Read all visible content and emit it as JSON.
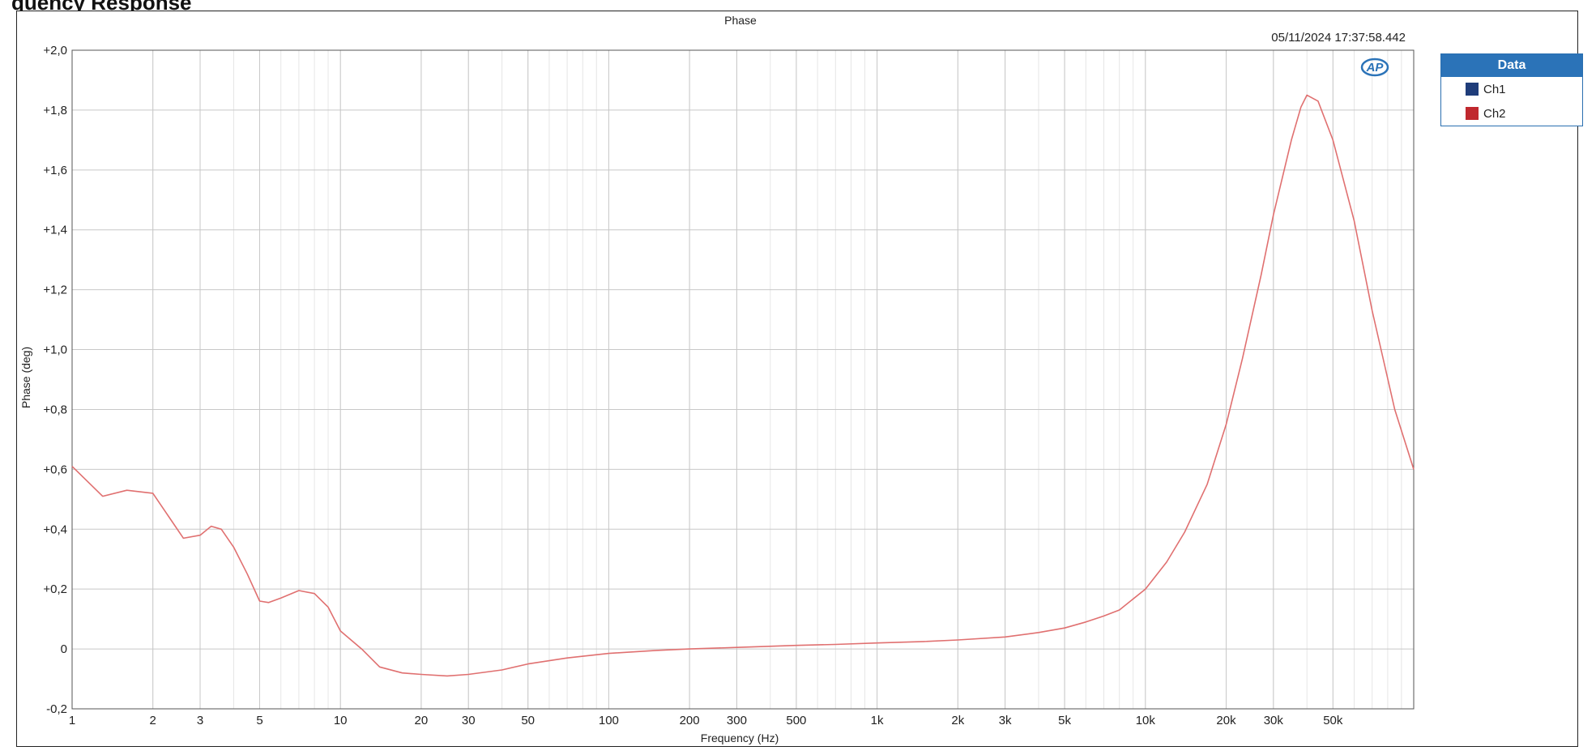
{
  "page_heading": "quency Response",
  "chart_data": {
    "type": "line",
    "title": "Phase",
    "timestamp": "05/11/2024 17:37:58.442",
    "xlabel": "Frequency (Hz)",
    "ylabel": "Phase (deg)",
    "x_scale": "log",
    "xlim": [
      1,
      100000
    ],
    "ylim": [
      -0.2,
      2.0
    ],
    "grid": true,
    "legend_position": "right",
    "x_ticks": [
      {
        "value": 1,
        "label": "1"
      },
      {
        "value": 2,
        "label": "2"
      },
      {
        "value": 3,
        "label": "3"
      },
      {
        "value": 5,
        "label": "5"
      },
      {
        "value": 10,
        "label": "10"
      },
      {
        "value": 20,
        "label": "20"
      },
      {
        "value": 30,
        "label": "30"
      },
      {
        "value": 50,
        "label": "50"
      },
      {
        "value": 100,
        "label": "100"
      },
      {
        "value": 200,
        "label": "200"
      },
      {
        "value": 300,
        "label": "300"
      },
      {
        "value": 500,
        "label": "500"
      },
      {
        "value": 1000,
        "label": "1k"
      },
      {
        "value": 2000,
        "label": "2k"
      },
      {
        "value": 3000,
        "label": "3k"
      },
      {
        "value": 5000,
        "label": "5k"
      },
      {
        "value": 10000,
        "label": "10k"
      },
      {
        "value": 20000,
        "label": "20k"
      },
      {
        "value": 30000,
        "label": "30k"
      },
      {
        "value": 50000,
        "label": "50k"
      }
    ],
    "y_ticks": [
      {
        "value": 2.0,
        "label": "+2,0"
      },
      {
        "value": 1.8,
        "label": "+1,8"
      },
      {
        "value": 1.6,
        "label": "+1,6"
      },
      {
        "value": 1.4,
        "label": "+1,4"
      },
      {
        "value": 1.2,
        "label": "+1,2"
      },
      {
        "value": 1.0,
        "label": "+1,0"
      },
      {
        "value": 0.8,
        "label": "+0,8"
      },
      {
        "value": 0.6,
        "label": "+0,6"
      },
      {
        "value": 0.4,
        "label": "+0,4"
      },
      {
        "value": 0.2,
        "label": "+0,2"
      },
      {
        "value": 0.0,
        "label": "0"
      },
      {
        "value": -0.2,
        "label": "-0,2"
      }
    ],
    "legend": {
      "header": "Data",
      "items": [
        {
          "name": "Ch1",
          "color": "#1f3d7a"
        },
        {
          "name": "Ch2",
          "color": "#c0282e"
        }
      ]
    },
    "series": [
      {
        "name": "Ch2",
        "color": "#e07070",
        "x": [
          1,
          1.3,
          1.6,
          2,
          2.3,
          2.6,
          3,
          3.3,
          3.6,
          4,
          4.5,
          5,
          5.4,
          6,
          7,
          8,
          9,
          10,
          12,
          14,
          17,
          20,
          25,
          30,
          40,
          50,
          70,
          100,
          150,
          200,
          300,
          500,
          700,
          1000,
          1500,
          2000,
          3000,
          4000,
          5000,
          6000,
          7000,
          8000,
          10000,
          12000,
          14000,
          17000,
          20000,
          23000,
          27000,
          30000,
          35000,
          38000,
          40000,
          44000,
          50000,
          60000,
          70000,
          85000,
          100000
        ],
        "y": [
          0.61,
          0.51,
          0.53,
          0.52,
          0.44,
          0.37,
          0.38,
          0.41,
          0.4,
          0.34,
          0.25,
          0.16,
          0.155,
          0.17,
          0.195,
          0.185,
          0.14,
          0.06,
          0.0,
          -0.06,
          -0.08,
          -0.085,
          -0.09,
          -0.085,
          -0.07,
          -0.05,
          -0.03,
          -0.015,
          -0.005,
          0.0,
          0.005,
          0.012,
          0.015,
          0.02,
          0.025,
          0.03,
          0.04,
          0.055,
          0.07,
          0.09,
          0.11,
          0.13,
          0.2,
          0.29,
          0.39,
          0.55,
          0.75,
          0.97,
          1.25,
          1.45,
          1.7,
          1.81,
          1.85,
          1.83,
          1.7,
          1.43,
          1.13,
          0.8,
          0.6
        ]
      }
    ]
  }
}
